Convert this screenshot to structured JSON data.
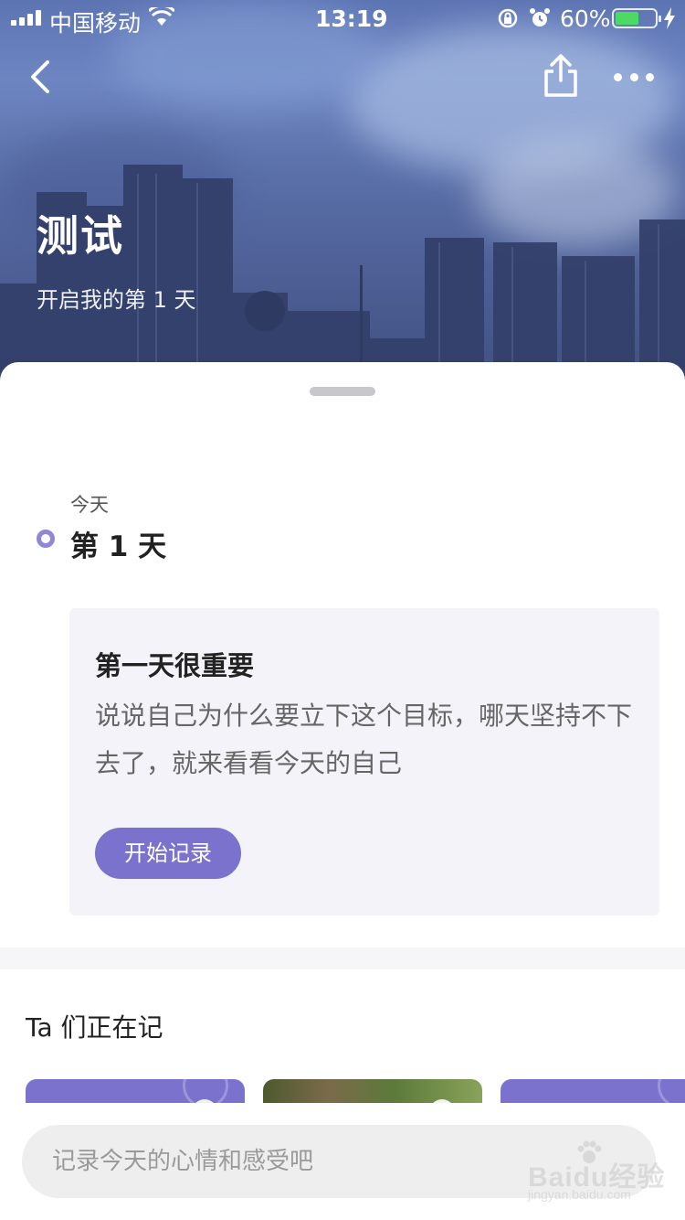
{
  "status_bar": {
    "carrier": "中国移动",
    "time": "13:19",
    "battery_percent": "60%",
    "battery_level": 0.6,
    "icons": [
      "signal-icon",
      "wifi-icon",
      "orientation-lock-icon",
      "alarm-icon",
      "battery-icon",
      "charging-icon"
    ]
  },
  "nav": {
    "back_icon": "chevron-left-icon",
    "share_icon": "share-icon",
    "more_icon": "more-dots-icon"
  },
  "hero": {
    "title": "测试",
    "subtitle": "开启我的第 1 天"
  },
  "timeline": {
    "date_label": "今天",
    "day_label": "第 1 天"
  },
  "prompt_card": {
    "title": "第一天很重要",
    "body": "说说自己为什么要立下这个目标，哪天坚持不下去了，就来看看今天的自己",
    "button_label": "开始记录"
  },
  "others_section": {
    "title": "Ta 们正在记"
  },
  "composer": {
    "placeholder": "记录今天的心情和感受吧"
  },
  "watermark": {
    "text": "Baidu经验",
    "sub": "jingyan.baidu.com"
  },
  "colors": {
    "accent": "#7a72cc",
    "card_bg": "#f3f3f9",
    "battery_green": "#4cd964"
  }
}
